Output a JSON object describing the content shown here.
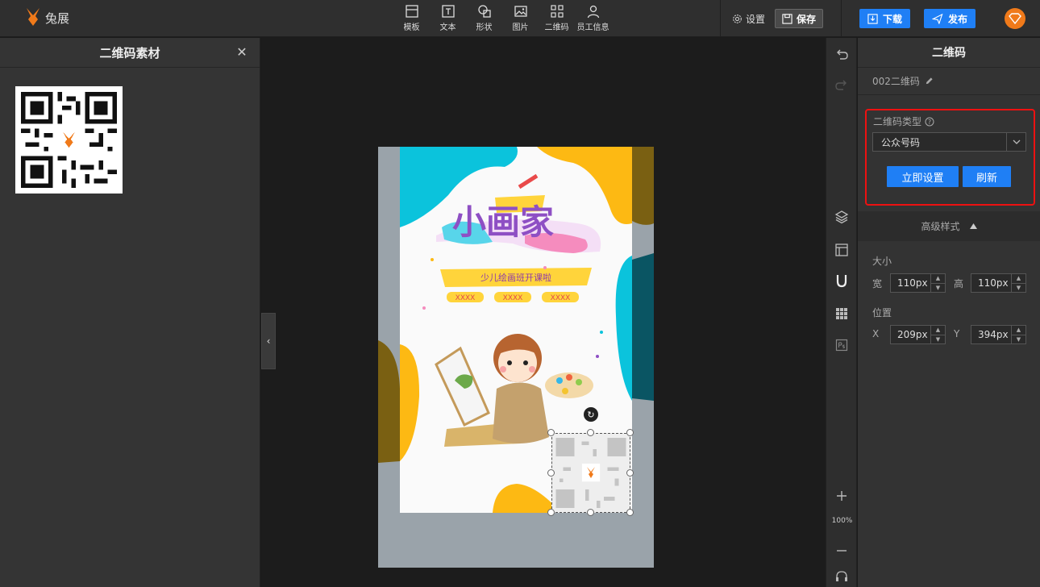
{
  "app": {
    "logo_text": "兔展"
  },
  "toolbar": {
    "tools": [
      {
        "label": "模板",
        "icon": "template-icon"
      },
      {
        "label": "文本",
        "icon": "text-icon"
      },
      {
        "label": "形状",
        "icon": "shape-icon"
      },
      {
        "label": "图片",
        "icon": "image-icon"
      },
      {
        "label": "二维码",
        "icon": "qrcode-icon"
      },
      {
        "label": "员工信息",
        "icon": "user-icon"
      }
    ],
    "settings_label": "设置",
    "save_label": "保存",
    "download_label": "下载",
    "publish_label": "发布"
  },
  "left_panel": {
    "title": "二维码素材"
  },
  "poster": {
    "title": "小画家",
    "subtitle": "少儿绘画班开课啦",
    "tags": [
      "XXXX",
      "XXXX",
      "XXXX"
    ]
  },
  "canvas": {
    "zoom": "100%"
  },
  "right_panel": {
    "title": "二维码",
    "element_name": "002二维码",
    "qr_type_label": "二维码类型",
    "qr_type_value": "公众号码",
    "set_now_label": "立即设置",
    "refresh_label": "刷新",
    "advanced_label": "高级样式",
    "size_label": "大小",
    "width_label": "宽",
    "width_value": "110px",
    "height_label": "高",
    "height_value": "110px",
    "position_label": "位置",
    "x_label": "X",
    "x_value": "209px",
    "y_label": "Y",
    "y_value": "394px"
  },
  "colors": {
    "accent": "#1f7ff5",
    "highlight": "#e11111",
    "brand": "#f07a1a"
  }
}
